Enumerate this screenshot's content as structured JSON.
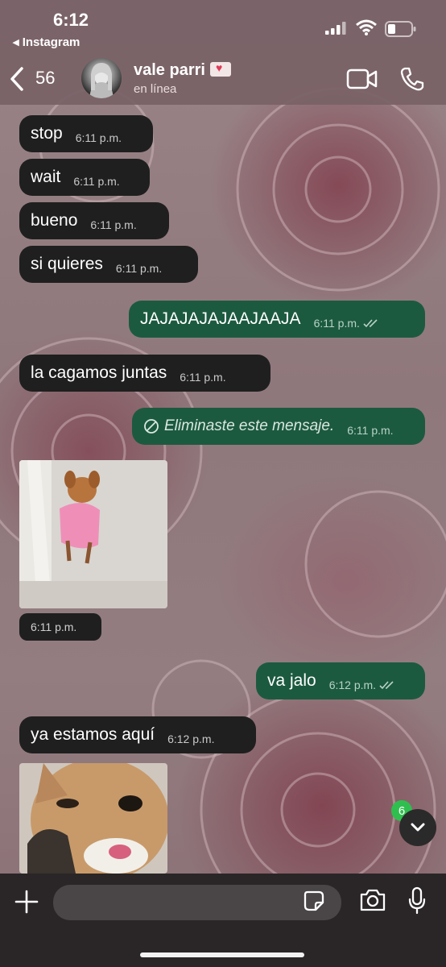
{
  "status_bar": {
    "time": "6:12",
    "back_app": "Instagram"
  },
  "header": {
    "unread_count": "56",
    "contact_name": "vale parri",
    "presence": "en línea"
  },
  "messages": [
    {
      "dir": "in",
      "text": "stop",
      "time": "6:11 p.m."
    },
    {
      "dir": "in",
      "text": "wait",
      "time": "6:11 p.m."
    },
    {
      "dir": "in",
      "text": "bueno",
      "time": "6:11 p.m."
    },
    {
      "dir": "in",
      "text": "si quieres",
      "time": "6:11 p.m."
    },
    {
      "dir": "out",
      "text": "JAJAJAJAJAAJAAJA",
      "time": "6:11 p.m.",
      "read": true
    },
    {
      "dir": "in",
      "text": "la cagamos juntas",
      "time": "6:11 p.m."
    },
    {
      "dir": "out",
      "text": "Eliminaste este mensaje.",
      "time": "6:11 p.m.",
      "deleted": true
    },
    {
      "dir": "in",
      "type": "image",
      "subject": "small dog in pink outfit",
      "time": "6:11 p.m."
    },
    {
      "dir": "out",
      "text": "va jalo",
      "time": "6:12 p.m.",
      "read": true
    },
    {
      "dir": "in",
      "text": "ya estamos aquí",
      "time": "6:12 p.m."
    },
    {
      "dir": "in",
      "type": "image",
      "subject": "cat close-up"
    }
  ],
  "scroll_badge": "6",
  "colors": {
    "incoming": "#1f1f1f",
    "outgoing": "#1c5a40",
    "badge": "#2fbf4f"
  }
}
